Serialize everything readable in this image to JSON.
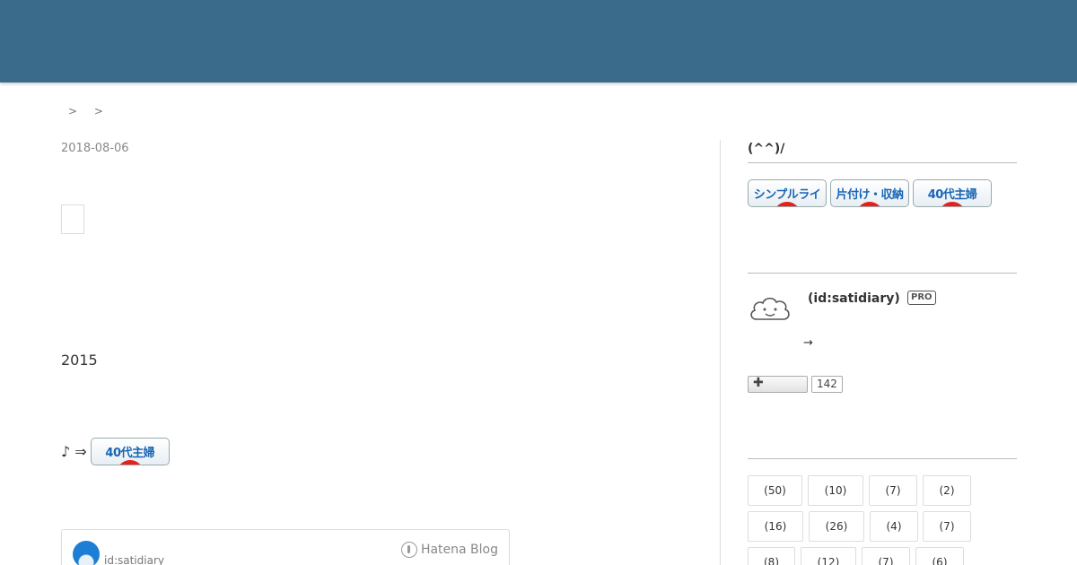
{
  "breadcrumb": [
    ">",
    ">"
  ],
  "article": {
    "date": "2018-08-06",
    "year_text": "2015",
    "line_text": "♪ ⇒",
    "banner_label": "40代主婦"
  },
  "author_card": {
    "id": "id:satidiary",
    "brand": "Hatena Blog"
  },
  "sidebar": {
    "heading": "(^^)/",
    "banners": [
      {
        "label": "シンプルライフ"
      },
      {
        "label": "片付け・収納"
      },
      {
        "label": "40代主婦"
      }
    ],
    "profile": {
      "id": "(id:satidiary)",
      "badge": "PRO",
      "arrow": "→"
    },
    "follow": {
      "plus": "✚",
      "count": "142"
    },
    "categories": [
      "(50)",
      "(10)",
      "(7)",
      "(2)",
      "(16)",
      "(26)",
      "(4)",
      "(7)",
      "(8)",
      "(12)",
      "(7)",
      "(6)"
    ]
  },
  "colors": {
    "header": "#3a6b8a",
    "banner_text": "#1765b5",
    "banner_dot": "#e8201c"
  }
}
